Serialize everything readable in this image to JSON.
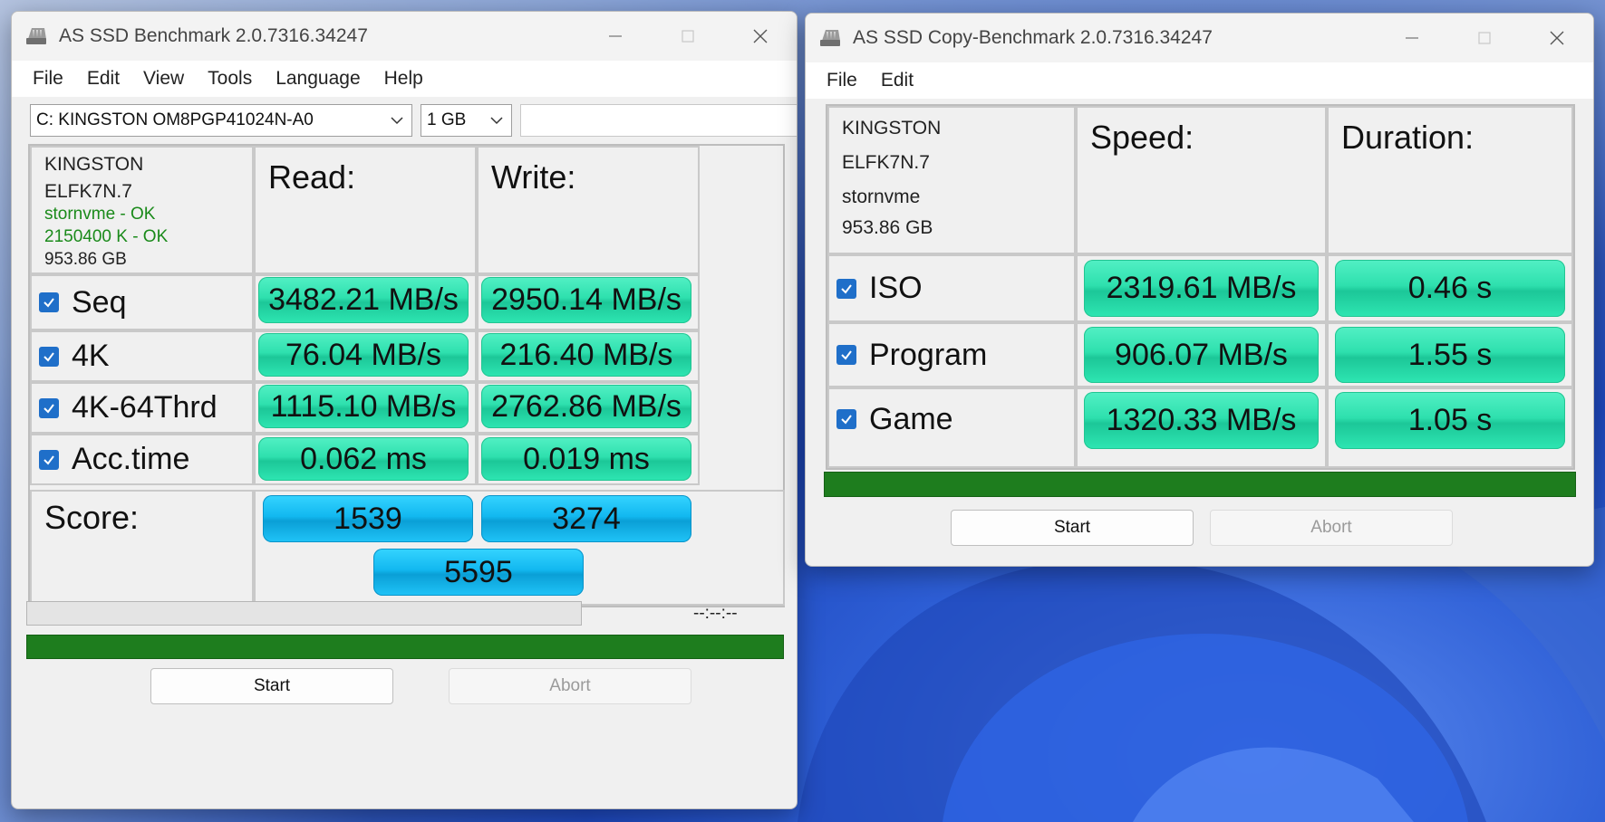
{
  "colors": {
    "result_green": "#2ee0ae",
    "score_blue": "#12b8f0",
    "progress_green": "#1e7d1e",
    "ok_text": "#1a8a1a",
    "checkbox_blue": "#1f6fc9"
  },
  "benchmark": {
    "title": "AS SSD Benchmark 2.0.7316.34247",
    "menu": [
      "File",
      "Edit",
      "View",
      "Tools",
      "Language",
      "Help"
    ],
    "drive_select": "C: KINGSTON OM8PGP41024N-A0",
    "size_select": "1 GB",
    "device": {
      "model": "KINGSTON",
      "firmware": "ELFK7N.7",
      "driver": "stornvme - OK",
      "alignment": "2150400 K - OK",
      "capacity": "953.86 GB"
    },
    "headers": {
      "read": "Read:",
      "write": "Write:"
    },
    "rows": [
      {
        "label": "Seq",
        "read": "3482.21 MB/s",
        "write": "2950.14 MB/s"
      },
      {
        "label": "4K",
        "read": "76.04 MB/s",
        "write": "216.40 MB/s"
      },
      {
        "label": "4K-64Thrd",
        "read": "1115.10 MB/s",
        "write": "2762.86 MB/s"
      },
      {
        "label": "Acc.time",
        "read": "0.062 ms",
        "write": "0.019 ms"
      }
    ],
    "score": {
      "label": "Score:",
      "read": "1539",
      "write": "3274",
      "total": "5595"
    },
    "time_display": "--:--:--",
    "start_label": "Start",
    "abort_label": "Abort"
  },
  "copy": {
    "title": "AS SSD Copy-Benchmark 2.0.7316.34247",
    "menu": [
      "File",
      "Edit"
    ],
    "device": {
      "model": "KINGSTON",
      "firmware": "ELFK7N.7",
      "driver": "stornvme",
      "capacity": "953.86 GB"
    },
    "headers": {
      "speed": "Speed:",
      "duration": "Duration:"
    },
    "rows": [
      {
        "label": "ISO",
        "speed": "2319.61 MB/s",
        "duration": "0.46 s"
      },
      {
        "label": "Program",
        "speed": "906.07 MB/s",
        "duration": "1.55 s"
      },
      {
        "label": "Game",
        "speed": "1320.33 MB/s",
        "duration": "1.05 s"
      }
    ],
    "start_label": "Start",
    "abort_label": "Abort"
  }
}
